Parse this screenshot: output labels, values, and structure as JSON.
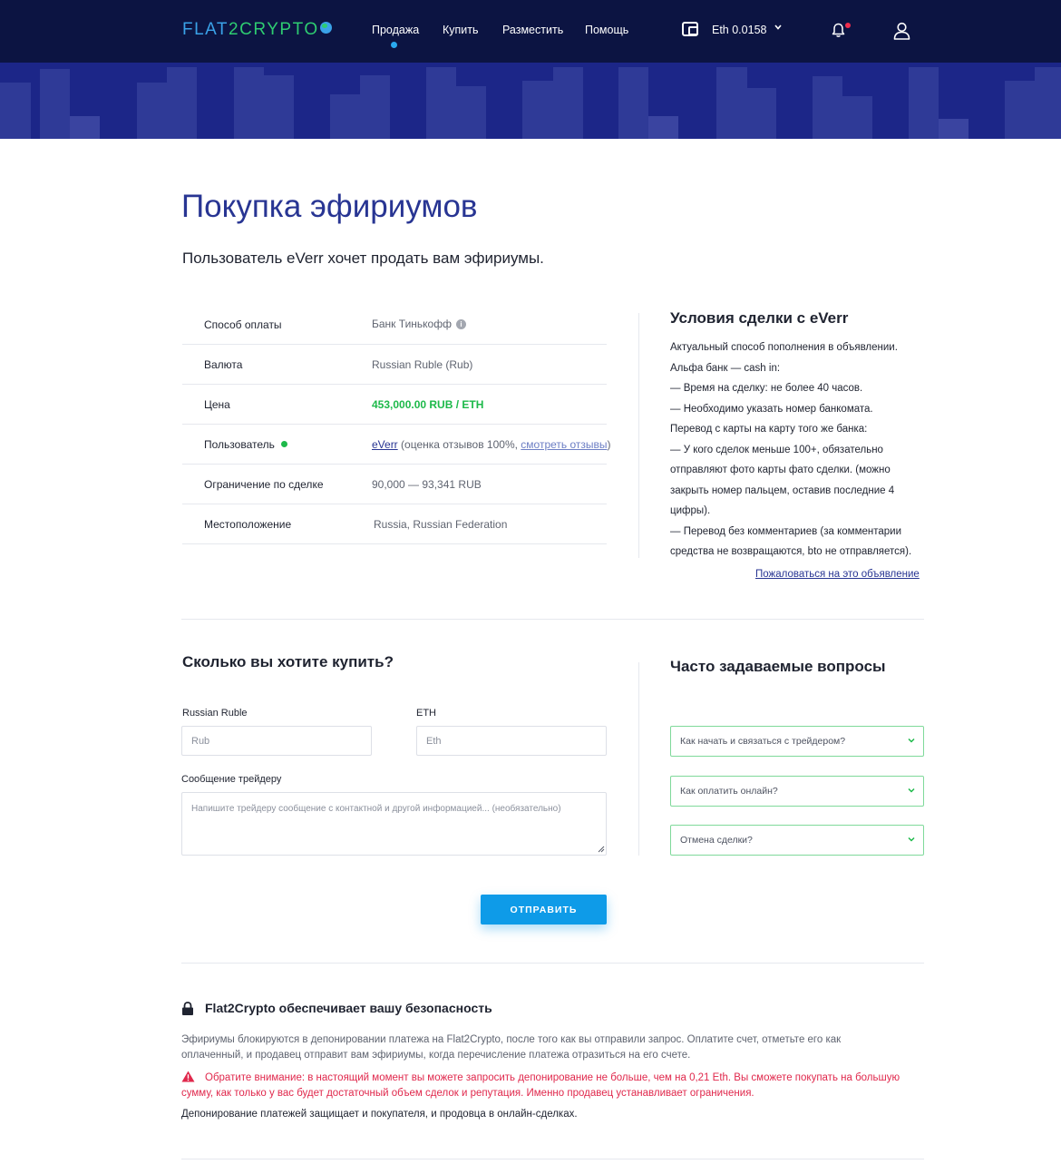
{
  "header": {
    "logo_part1": "FLAT",
    "logo_part2": "2",
    "logo_part3": "CRYPTO",
    "nav": [
      "Продажа",
      "Купить",
      "Разместить",
      "Помощь"
    ],
    "active_nav": "Продажа",
    "balance": "Eth 0.0158",
    "has_notification": true
  },
  "page": {
    "title": "Покупка эфириумов",
    "subtitle": "Пользователь eVerr хочет продать вам эфириумы."
  },
  "details": {
    "rows": [
      {
        "label": "Способ оплаты",
        "value": "Банк Тинькофф"
      },
      {
        "label": "Валюта",
        "value": "Russian Ruble (Rub)"
      },
      {
        "label": "Цена",
        "value": "453,000.00 RUB / ETH"
      },
      {
        "label": "Пользователь",
        "user_link": "eVerr",
        "rating_text": "(оценка отзывов 100%,",
        "reviews_link": "смотреть отзывы",
        "closing": ")"
      },
      {
        "label": "Ограничение по сделке",
        "value": "90,000 — 93,341 RUB"
      },
      {
        "label": "Местоположение",
        "value": "Russia, Russian Federation"
      }
    ]
  },
  "conditions": {
    "title": "Условия сделки с eVerr",
    "lines": [
      "Актуальный способ пополнения в объявлении.",
      "Альфа банк — cash in:",
      "— Время на сделку: не более 40 часов.",
      "— Необходимо указать номер банкомата.",
      "Перевод с карты на карту того же банка:",
      "— У кого сделок меньше 100+, обязательно",
      "отправляют фото карты фато сделки. (можно",
      "закрыть номер пальцем, оставив последние 4",
      "цифры).",
      "— Перевод без комментариев (за комментарии",
      "средства не возвращаются, bto не отправляется)."
    ],
    "complain_link": "Пожаловаться на это объявление"
  },
  "buy_form": {
    "title": "Сколько вы хотите купить?",
    "rub_label": "Russian Ruble",
    "rub_placeholder": "Rub",
    "eth_label": "ETH",
    "eth_placeholder": "Eth",
    "message_label": "Сообщение трейдеру",
    "message_placeholder": "Напишите трейдеру сообщение с контактной и другой информацией... (необязательно)",
    "submit": "ОТПРАВИТЬ"
  },
  "faq": {
    "title": "Часто задаваемые вопросы",
    "items": [
      "Как начать и связаться с трейдером?",
      "Как оплатить онлайн?",
      "Отмена сделки?"
    ]
  },
  "security": {
    "title": "Flat2Crypto обеспечивает вашу безопасность",
    "p1": "Эфириумы блокируются в депонировании платежа на Flat2Crypto, после того как вы отправили запрос. Оплатите счет, отметьте его как оплаченный, и продавец отправит вам эфириумы, когда перечисление платежа отразиться на его счете.",
    "warning": "Обратите внимание: в настоящий момент вы можете запросить депонирование не больше, чем на 0,21 Eth. Вы сможете покупать на большую сумму, как только у вас будет достаточный объем сделок и репутация. Именно продавец устанавливает ограничения.",
    "p3": "Депонирование платежей защищает и покупателя, и продовца в онлайн-сделках."
  },
  "colors": {
    "header_bg": "#0c1442",
    "banner_bg": "#1c2688",
    "accent_blue": "#283593",
    "button_blue": "#0e9be8",
    "price_green": "#1db94a",
    "warning_red": "#e0284c"
  }
}
